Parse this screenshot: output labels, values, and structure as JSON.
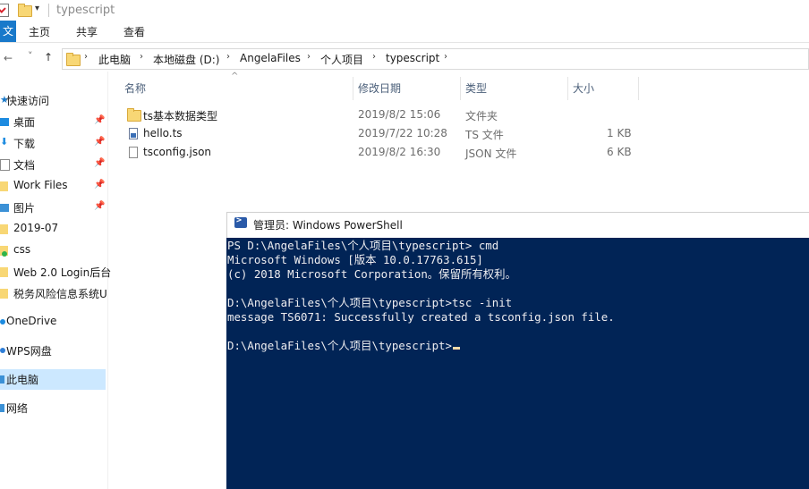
{
  "window": {
    "title": "typescript"
  },
  "ribbon": {
    "file_tab": "文",
    "tabs": [
      "主页",
      "共享",
      "查看"
    ]
  },
  "nav": {
    "back": "←",
    "forward": "→",
    "recent": "˅",
    "up": "↑"
  },
  "breadcrumb": {
    "items": [
      "此电脑",
      "本地磁盘 (D:)",
      "AngelaFiles",
      "个人项目",
      "typescript"
    ]
  },
  "sidebar": {
    "quick_access": "快速访问",
    "items": [
      {
        "label": "桌面",
        "pinned": true
      },
      {
        "label": "下载",
        "pinned": true
      },
      {
        "label": "文档",
        "pinned": true
      },
      {
        "label": "Work Files",
        "pinned": true
      },
      {
        "label": "图片",
        "pinned": true
      },
      {
        "label": "2019-07",
        "pinned": false
      },
      {
        "label": "css",
        "pinned": false
      },
      {
        "label": "Web 2.0 Login后台",
        "pinned": false
      },
      {
        "label": "税务风险信息系统U",
        "pinned": false
      }
    ],
    "onedrive": "OneDrive",
    "wps": "WPS网盘",
    "this_pc": "此电脑",
    "network": "网络"
  },
  "file_list": {
    "columns": [
      "名称",
      "修改日期",
      "类型",
      "大小"
    ],
    "rows": [
      {
        "name": "ts基本数据类型",
        "date": "2019/8/2 15:06",
        "type": "文件夹",
        "size": "",
        "icon": "folder-icon"
      },
      {
        "name": "hello.ts",
        "date": "2019/7/22 10:28",
        "type": "TS 文件",
        "size": "1 KB",
        "icon": "ts-file-icon"
      },
      {
        "name": "tsconfig.json",
        "date": "2019/8/2 16:30",
        "type": "JSON 文件",
        "size": "6 KB",
        "icon": "file-icon"
      }
    ]
  },
  "powershell": {
    "title": "管理员: Windows PowerShell",
    "lines": [
      "PS D:\\AngelaFiles\\个人项目\\typescript> cmd",
      "Microsoft Windows [版本 10.0.17763.615]",
      "(c) 2018 Microsoft Corporation。保留所有权利。",
      "",
      "D:\\AngelaFiles\\个人项目\\typescript>tsc -init",
      "message TS6071: Successfully created a tsconfig.json file.",
      "",
      "D:\\AngelaFiles\\个人项目\\typescript>"
    ],
    "colors": {
      "background": "#012456",
      "text": "#eeedf0",
      "cursor": "#fedba9"
    }
  }
}
